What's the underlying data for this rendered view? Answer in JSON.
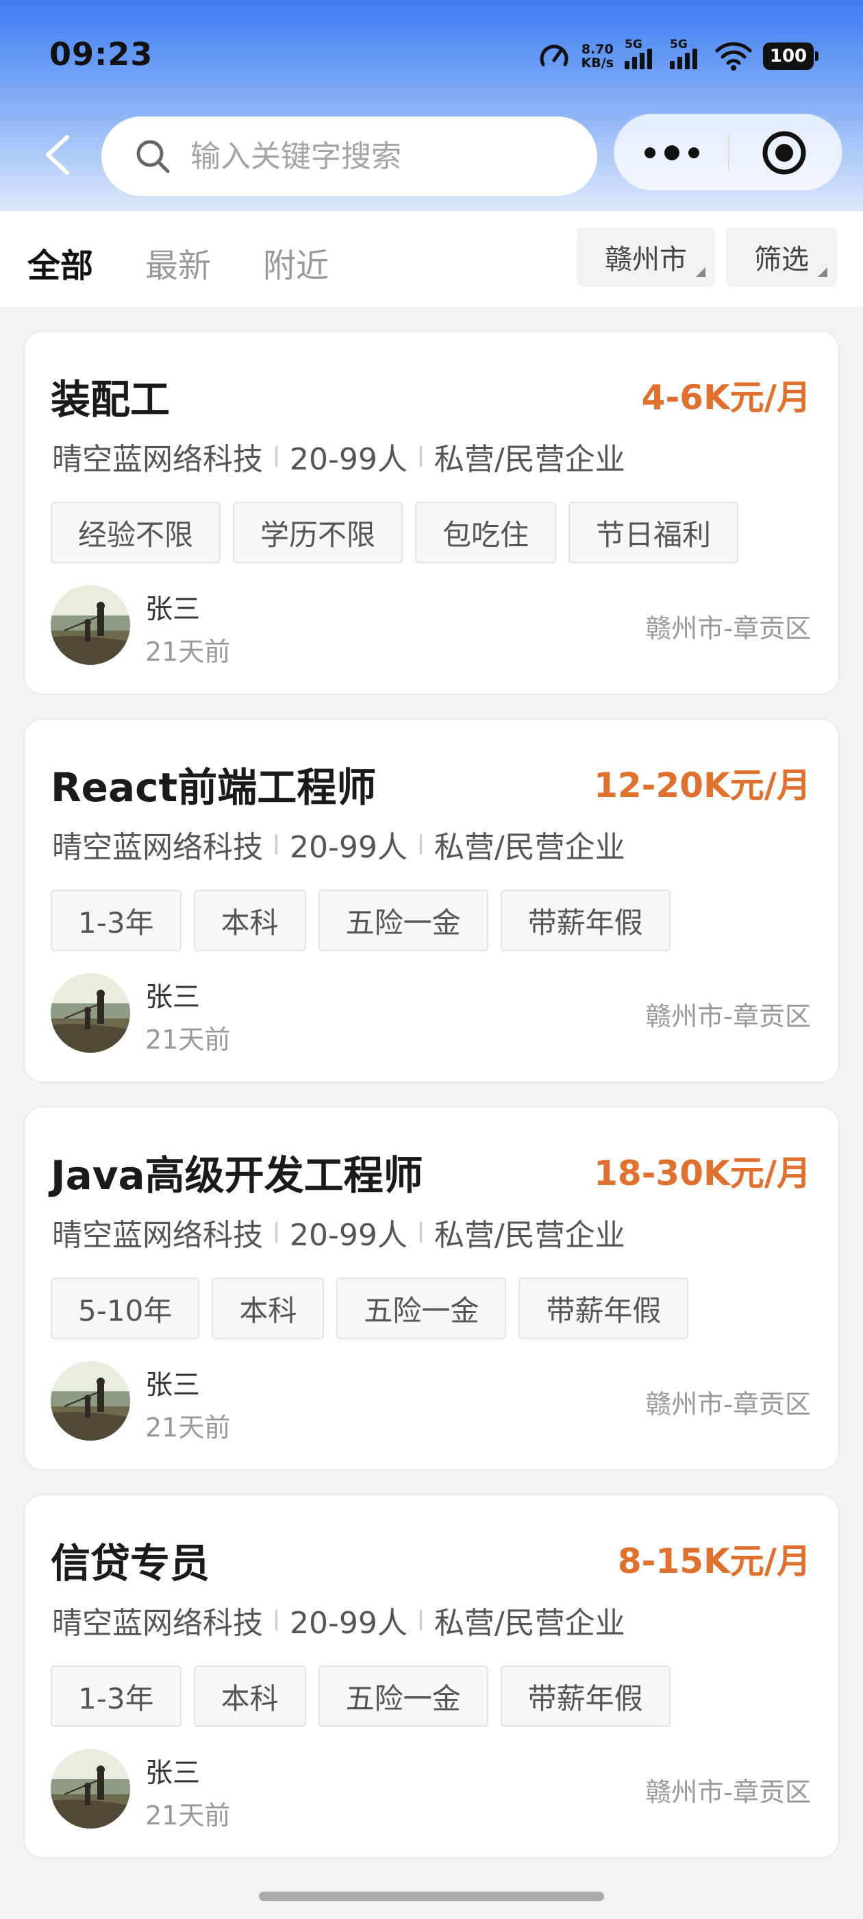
{
  "status": {
    "time": "09:23",
    "net_speed_value": "8.70",
    "net_speed_unit": "KB/s",
    "sim1": "5G",
    "sim2": "5G",
    "battery": "100"
  },
  "search": {
    "placeholder": "输入关键字搜索"
  },
  "tabs": [
    {
      "label": "全部",
      "active": true
    },
    {
      "label": "最新",
      "active": false
    },
    {
      "label": "附近",
      "active": false
    }
  ],
  "filters": {
    "city": "赣州市",
    "filter": "筛选"
  },
  "colors": {
    "salary": "#e0702e",
    "header_top": "#3d7df0"
  },
  "jobs": [
    {
      "title": "装配工",
      "salary": "4-6K元/月",
      "company": "晴空蓝网络科技",
      "size": "20-99人",
      "type": "私营/民营企业",
      "tags": [
        "经验不限",
        "学历不限",
        "包吃住",
        "节日福利"
      ],
      "recruiter": "张三",
      "posted": "21天前",
      "location": "赣州市-章贡区"
    },
    {
      "title": "React前端工程师",
      "salary": "12-20K元/月",
      "company": "晴空蓝网络科技",
      "size": "20-99人",
      "type": "私营/民营企业",
      "tags": [
        "1-3年",
        "本科",
        "五险一金",
        "带薪年假"
      ],
      "recruiter": "张三",
      "posted": "21天前",
      "location": "赣州市-章贡区"
    },
    {
      "title": "Java高级开发工程师",
      "salary": "18-30K元/月",
      "company": "晴空蓝网络科技",
      "size": "20-99人",
      "type": "私营/民营企业",
      "tags": [
        "5-10年",
        "本科",
        "五险一金",
        "带薪年假"
      ],
      "recruiter": "张三",
      "posted": "21天前",
      "location": "赣州市-章贡区"
    },
    {
      "title": "信贷专员",
      "salary": "8-15K元/月",
      "company": "晴空蓝网络科技",
      "size": "20-99人",
      "type": "私营/民营企业",
      "tags": [
        "1-3年",
        "本科",
        "五险一金",
        "带薪年假"
      ],
      "recruiter": "张三",
      "posted": "21天前",
      "location": "赣州市-章贡区"
    }
  ]
}
